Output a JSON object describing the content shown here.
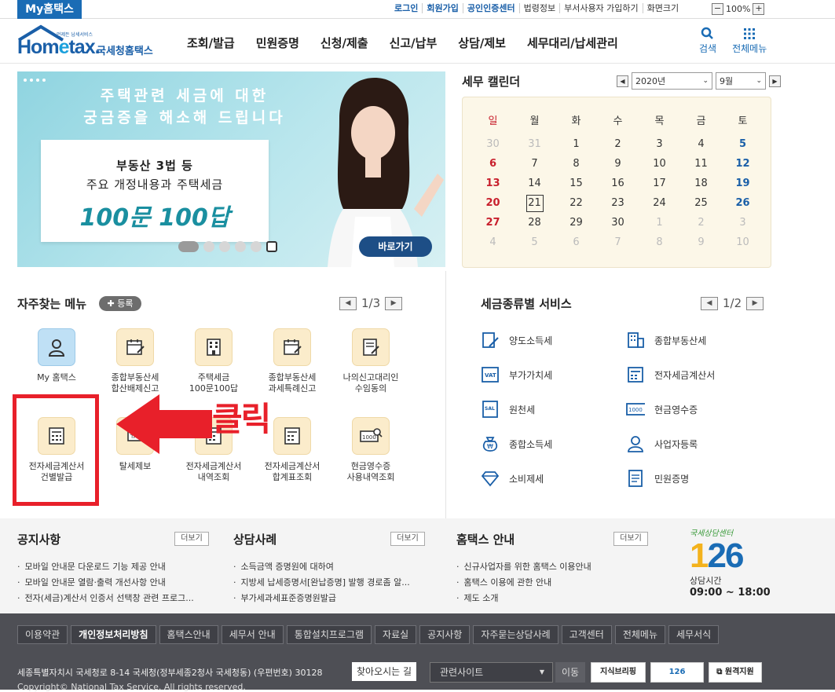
{
  "topbar": {
    "my_tab": "My홈택스",
    "util": [
      "로그인",
      "회원가입",
      "공인인증센터",
      "법령정보",
      "부서사용자 가입하기",
      "화면크기"
    ],
    "zoom": "100%",
    "zoom_minus": "−",
    "zoom_plus": "+"
  },
  "header": {
    "logo_small": "언제든 납세서비스",
    "logo_text_1": "Hom",
    "logo_text_o": "e",
    "logo_text_2": "tax.",
    "logo_korean": "국세청홈택스",
    "nav": [
      "조회/발급",
      "민원증명",
      "신청/제출",
      "신고/납부",
      "상담/제보",
      "세무대리/납세관리"
    ],
    "search_label": "검색",
    "all_menu_label": "전체메뉴"
  },
  "banner": {
    "title_line1": "주택관련 세금에 대한",
    "title_line2": "궁금증을 해소해 드립니다",
    "card_line1": "부동산 3법 등",
    "card_line2": "주요 개정내용과 주택세금",
    "card_line3": "100문 100답",
    "go_button": "바로가기"
  },
  "calendar": {
    "title": "세무 캘린더",
    "year": "2020년",
    "month": "9월",
    "weekdays": [
      "일",
      "월",
      "화",
      "수",
      "목",
      "금",
      "토"
    ],
    "weeks": [
      [
        "30",
        "31",
        "1",
        "2",
        "3",
        "4",
        "5"
      ],
      [
        "6",
        "7",
        "8",
        "9",
        "10",
        "11",
        "12"
      ],
      [
        "13",
        "14",
        "15",
        "16",
        "17",
        "18",
        "19"
      ],
      [
        "20",
        "21",
        "22",
        "23",
        "24",
        "25",
        "26"
      ],
      [
        "27",
        "28",
        "29",
        "30",
        "1",
        "2",
        "3"
      ],
      [
        "4",
        "5",
        "6",
        "7",
        "8",
        "9",
        "10"
      ]
    ],
    "today": "21"
  },
  "frequent": {
    "title": "자주찾는 메뉴",
    "register": "등록",
    "page": "1/3",
    "tiles": [
      {
        "label": "My 홈택스"
      },
      {
        "label": "종합부동산세\n합산배제신고"
      },
      {
        "label": "주택세금\n100문100답"
      },
      {
        "label": "종합부동산세\n과세특례신고"
      },
      {
        "label": "나의신고대리인\n수임동의"
      },
      {
        "label": "전자세금계산서\n건별발급"
      },
      {
        "label": "탈세제보"
      },
      {
        "label": "전자세금계산서\n내역조회"
      },
      {
        "label": "전자세금계산서\n합계표조회"
      },
      {
        "label": "현금영수증\n사용내역조회"
      }
    ]
  },
  "annotation": {
    "click_text": "클릭"
  },
  "tax_services": {
    "title": "세금종류별 서비스",
    "page": "1/2",
    "items": [
      "양도소득세",
      "종합부동산세",
      "부가가치세",
      "전자세금계산서",
      "원천세",
      "현금영수증",
      "종합소득세",
      "사업자등록",
      "소비제세",
      "민원증명"
    ]
  },
  "notices": {
    "more": "더보기",
    "sections": [
      {
        "title": "공지사항",
        "items": [
          "모바일 안내문 다운로드 기능 제공 안내",
          "모바일 안내문 열람·출력 개선사항 안내",
          "전자(세금)계산서 인증서 선택창 관련 프로그..."
        ]
      },
      {
        "title": "상담사례",
        "items": [
          "소득금액 증명원에 대하여",
          "지방세 납세증명서[완납증명] 발행 경로좀 알...",
          "부가세과세표준증명원발급"
        ]
      },
      {
        "title": "홈택스 안내",
        "items": [
          "신규사업자를 위한 홈택스 이용안내",
          "홈택스 이용에 관한 안내",
          "제도 소개"
        ]
      }
    ],
    "center_script": "국세상담센터",
    "center_num_1": "1",
    "center_num_2": "26",
    "center_hours_label": "상담시간",
    "center_hours": "09:00 ~ 18:00"
  },
  "footer": {
    "links": [
      "이용약관",
      "개인정보처리방침",
      "홈택스안내",
      "세무서 안내",
      "통합설치프로그램",
      "자료실",
      "공지사항",
      "자주묻는상담사례",
      "고객센터",
      "전체메뉴",
      "세무서식"
    ],
    "address": "세종특별자치시 국세청로 8-14 국세청(정부세종2청사 국세청동) (우편번호) 30128",
    "map_button": "찾아오시는 길",
    "copyright": "Copyright© National Tax Service. All rights reserved.",
    "related_select": "관련사이트",
    "go": "이동",
    "badge1": "지식브리핑",
    "badge2": "126",
    "badge3": "원격지원"
  },
  "colors": {
    "brand": "#1a6cb5",
    "annotation_red": "#e8202a",
    "calendar_bg": "#fcf7e8",
    "footer_bg": "#4e4f55"
  }
}
